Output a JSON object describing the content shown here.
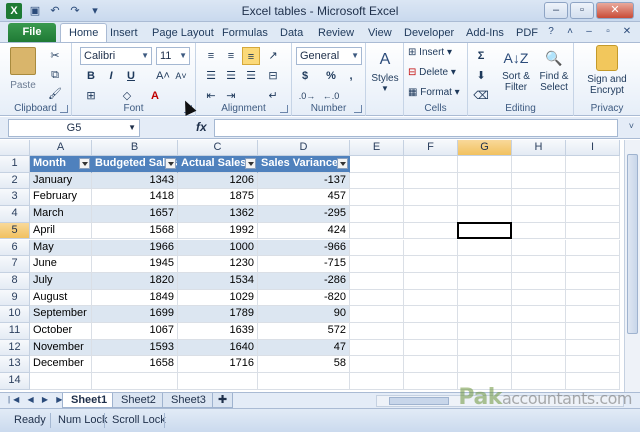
{
  "window": {
    "title": "Excel tables  -  Microsoft Excel",
    "app_icon": "X",
    "controls": [
      "–",
      "▫",
      "✕"
    ]
  },
  "qat_icons": [
    "save-icon",
    "undo-icon",
    "redo-icon",
    "customize-icon"
  ],
  "ribbon_tabs": {
    "file": "File",
    "tabs": [
      "Home",
      "Insert",
      "Page Layout",
      "Formulas",
      "Data",
      "Review",
      "View",
      "Developer",
      "Add-Ins",
      "PDF"
    ],
    "active": "Home"
  },
  "ribbon": {
    "clipboard": {
      "label": "Clipboard",
      "paste": "Paste"
    },
    "font": {
      "label": "Font",
      "name": "Calibri",
      "size": "11",
      "bold": "B",
      "italic": "I",
      "underline": "U",
      "grow": "A˄",
      "shrink": "A˅"
    },
    "alignment": {
      "label": "Alignment"
    },
    "number": {
      "label": "Number",
      "format": "General",
      "currency": "$",
      "percent": "%",
      "comma": ","
    },
    "styles": {
      "label": "Styles"
    },
    "cells": {
      "label": "Cells",
      "insert": "Insert",
      "delete": "Delete",
      "format": "Format"
    },
    "editing": {
      "label": "Editing",
      "sort": "Sort &",
      "sort2": "Filter",
      "find": "Find &",
      "find2": "Select"
    },
    "privacy": {
      "label": "Privacy",
      "sign": "Sign and",
      "sign2": "Encrypt"
    }
  },
  "formula_bar": {
    "name_box": "G5",
    "fx": "fx",
    "value": ""
  },
  "grid": {
    "columns": [
      "A",
      "B",
      "C",
      "D",
      "E",
      "F",
      "G",
      "H",
      "I"
    ],
    "selected_column": "G",
    "rows": [
      "1",
      "2",
      "3",
      "4",
      "5",
      "6",
      "7",
      "8",
      "9",
      "10",
      "11",
      "12",
      "13",
      "14"
    ],
    "selected_row": "5",
    "table_headers": [
      "Month",
      "Budgeted Sales",
      "Actual Sales",
      "Sales Variance"
    ],
    "table_rows": [
      [
        "January",
        "1343",
        "1206",
        "-137"
      ],
      [
        "February",
        "1418",
        "1875",
        "457"
      ],
      [
        "March",
        "1657",
        "1362",
        "-295"
      ],
      [
        "April",
        "1568",
        "1992",
        "424"
      ],
      [
        "May",
        "1966",
        "1000",
        "-966"
      ],
      [
        "June",
        "1945",
        "1230",
        "-715"
      ],
      [
        "July",
        "1820",
        "1534",
        "-286"
      ],
      [
        "August",
        "1849",
        "1029",
        "-820"
      ],
      [
        "September",
        "1699",
        "1789",
        "90"
      ],
      [
        "October",
        "1067",
        "1639",
        "572"
      ],
      [
        "November",
        "1593",
        "1640",
        "47"
      ],
      [
        "December",
        "1658",
        "1716",
        "58"
      ]
    ]
  },
  "sheets": {
    "tabs": [
      "Sheet1",
      "Sheet2",
      "Sheet3"
    ],
    "active": "Sheet1"
  },
  "status": {
    "ready": "Ready",
    "num_lock": "Num Lock",
    "scroll_lock": "Scroll Lock"
  },
  "watermark": {
    "brand": "Pak",
    "rest": "accountants.com"
  }
}
